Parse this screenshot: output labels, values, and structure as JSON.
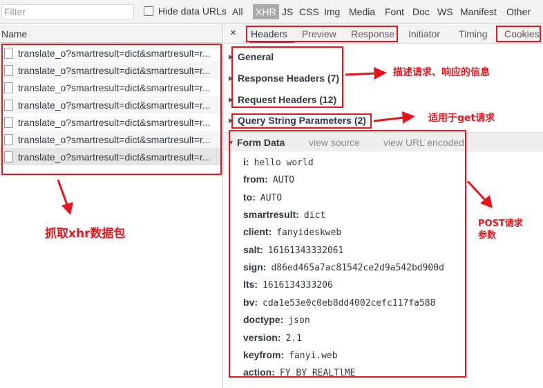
{
  "filter": {
    "placeholder": "Filter",
    "value": ""
  },
  "hide_data_urls": {
    "label": "Hide data URLs",
    "checked": false
  },
  "type_filters": [
    {
      "label": "All",
      "active": false
    },
    {
      "label": "XHR",
      "active": true
    },
    {
      "label": "JS",
      "active": false
    },
    {
      "label": "CSS",
      "active": false
    },
    {
      "label": "Img",
      "active": false
    },
    {
      "label": "Media",
      "active": false
    },
    {
      "label": "Font",
      "active": false
    },
    {
      "label": "Doc",
      "active": false
    },
    {
      "label": "WS",
      "active": false
    },
    {
      "label": "Manifest",
      "active": false
    },
    {
      "label": "Other",
      "active": false
    }
  ],
  "name_column": {
    "header": "Name"
  },
  "requests": [
    "translate_o?smartresult=dict&smartresult=r...",
    "translate_o?smartresult=dict&smartresult=r...",
    "translate_o?smartresult=dict&smartresult=r...",
    "translate_o?smartresult=dict&smartresult=r...",
    "translate_o?smartresult=dict&smartresult=r...",
    "translate_o?smartresult=dict&smartresult=r...",
    "translate_o?smartresult=dict&smartresult=r..."
  ],
  "close_symbol": "×",
  "tabs": [
    {
      "label": "Headers",
      "active": true
    },
    {
      "label": "Preview",
      "active": false
    },
    {
      "label": "Response",
      "active": false
    },
    {
      "label": "Initiator",
      "active": false
    },
    {
      "label": "Timing",
      "active": false
    },
    {
      "label": "Cookies",
      "active": false
    }
  ],
  "sections": {
    "general": "General",
    "response_headers": "Response Headers (7)",
    "request_headers": "Request Headers (12)",
    "query_string": "Query String Parameters (2)",
    "form_data": "Form Data",
    "view_source": "view source",
    "view_url_encoded": "view URL encoded"
  },
  "form_params": [
    {
      "key": "i:",
      "value": "hello world"
    },
    {
      "key": "from:",
      "value": "AUTO"
    },
    {
      "key": "to:",
      "value": "AUTO"
    },
    {
      "key": "smartresult:",
      "value": "dict"
    },
    {
      "key": "client:",
      "value": "fanyideskweb"
    },
    {
      "key": "salt:",
      "value": "16161343332061"
    },
    {
      "key": "sign:",
      "value": "d86ed465a7ac81542ce2d9a542bd900d"
    },
    {
      "key": "lts:",
      "value": "1616134333206"
    },
    {
      "key": "bv:",
      "value": "cda1e53e0c0eb8dd4002cefc117fa588"
    },
    {
      "key": "doctype:",
      "value": "json"
    },
    {
      "key": "version:",
      "value": "2.1"
    },
    {
      "key": "keyfrom:",
      "value": "fanyi.web"
    },
    {
      "key": "action:",
      "value": "FY_BY_REALTlME"
    }
  ],
  "annotations": {
    "headers_info": "描述请求、响应的信息",
    "get_params": "适用于get请求",
    "capture_xhr": "抓取xhr数据包",
    "post_params_line1": "POST请求",
    "post_params_line2": "参数",
    "color": "#e8141c"
  }
}
